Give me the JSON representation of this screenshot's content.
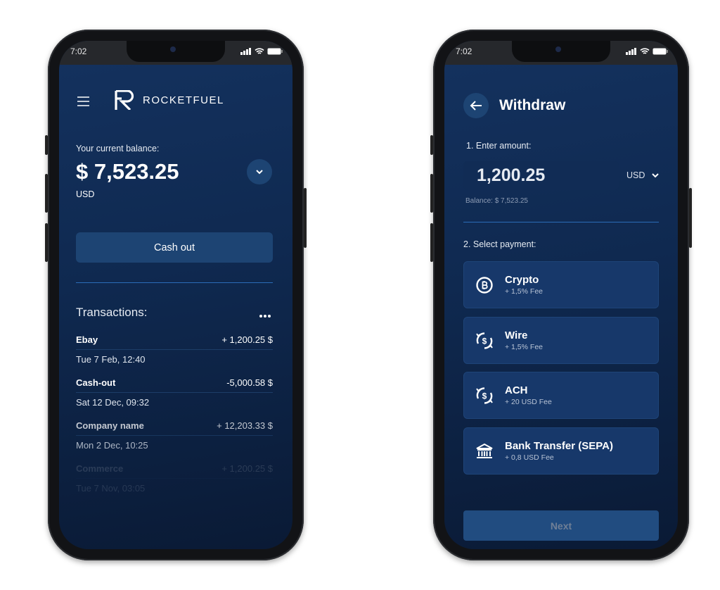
{
  "status_bar": {
    "time": "7:02"
  },
  "home": {
    "logo_text": "ROCKETFUEL",
    "balance_label": "Your current balance:",
    "balance_amount": "$ 7,523.25",
    "currency": "USD",
    "cash_out_label": "Cash out",
    "transactions_title": "Transactions:",
    "transactions": [
      {
        "name": "Ebay",
        "amount": "+ 1,200.25 $",
        "date": "Tue 7 Feb, 12:40"
      },
      {
        "name": "Cash-out",
        "amount": "-5,000.58 $",
        "date": "Sat 12 Dec, 09:32"
      },
      {
        "name": "Company name",
        "amount": "+ 12,203.33 $",
        "date": "Mon 2 Dec, 10:25"
      },
      {
        "name": "Commerce",
        "amount": "+ 1,200.25 $",
        "date": "Tue 7 Nov, 03:05"
      }
    ]
  },
  "withdraw": {
    "title": "Withdraw",
    "step1_label": "1. Enter amount:",
    "amount_value": "1,200.25",
    "currency": "USD",
    "balance_text": "Balance: $ 7,523.25",
    "step2_label": "2. Select payment:",
    "payment_methods": [
      {
        "title": "Crypto",
        "fee": "+ 1,5% Fee",
        "icon": "bitcoin-coin-icon"
      },
      {
        "title": "Wire",
        "fee": "+ 1,5% Fee",
        "icon": "dollar-exchange-icon"
      },
      {
        "title": "ACH",
        "fee": "+ 20 USD Fee",
        "icon": "dollar-exchange-icon"
      },
      {
        "title": "Bank Transfer (SEPA)",
        "fee": "+ 0,8 USD Fee",
        "icon": "bank-icon"
      }
    ],
    "next_label": "Next"
  },
  "colors": {
    "background": "#0f2950",
    "card": "#17386a",
    "button": "#1d4473",
    "divider": "#2b6cb8"
  }
}
